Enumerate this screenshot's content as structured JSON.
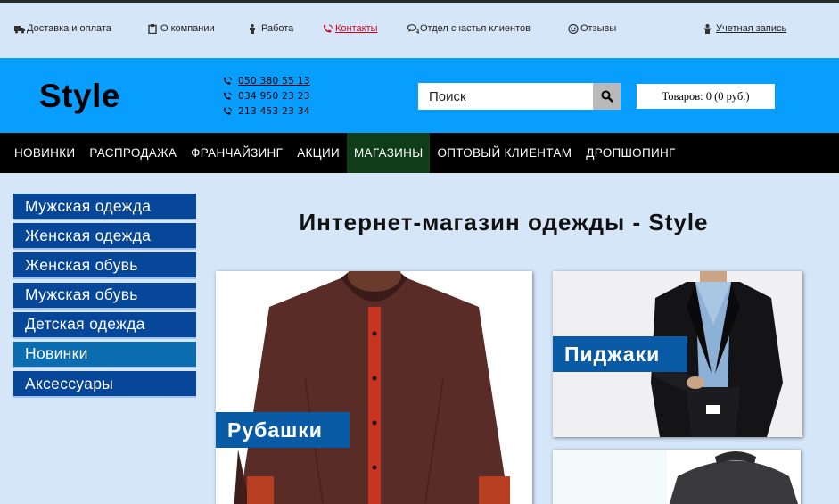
{
  "topbar": {
    "delivery": "Доставка и оплата",
    "about": "О компании",
    "jobs": "Работа",
    "contacts": "Контакты",
    "happiness": "Отдел счастья клиентов",
    "reviews": "Отзывы",
    "account": "Учетная запись"
  },
  "header": {
    "logo": "Style",
    "phones": [
      "050 380 55 13",
      "034 950 23 23",
      "213 453 23 34"
    ],
    "search_placeholder": "Поиск",
    "cart": "Товаров: 0 (0 руб.)"
  },
  "nav": {
    "items": [
      "НОВИНКИ",
      "РАСПРОДАЖА",
      "ФРАНЧАЙЗИНГ",
      "АКЦИИ",
      "МАГАЗИНЫ",
      "ОПТОВЫЙ КЛИЕНТАМ",
      "ДРОПШОПИНГ"
    ],
    "active": "МАГАЗИНЫ"
  },
  "sidebar": {
    "categories": [
      "Мужская одежда",
      "Женская одежда",
      "Женская обувь",
      "Мужская обувь",
      "Детская одежда",
      "Новинки",
      "Аксессуары"
    ]
  },
  "main": {
    "title": "Интернет-магазин одежды - Style",
    "cards": [
      "Рубашки",
      "Пиджаки"
    ]
  },
  "colors": {
    "page_bg": "#d6e6f9",
    "header_bg": "#079efd",
    "nav_bg": "#000000",
    "nav_active_bg": "#0f3d18",
    "category_bg": "#06479a",
    "category_highlight_bg": "#0b6cb0",
    "label_bg": "#0a5ba6",
    "contacts_red": "#d8001a"
  },
  "icons": [
    "truck-icon",
    "clipboard-icon",
    "person-icon",
    "phone-icon",
    "chat-icon",
    "smile-icon",
    "user-icon",
    "search-icon"
  ]
}
